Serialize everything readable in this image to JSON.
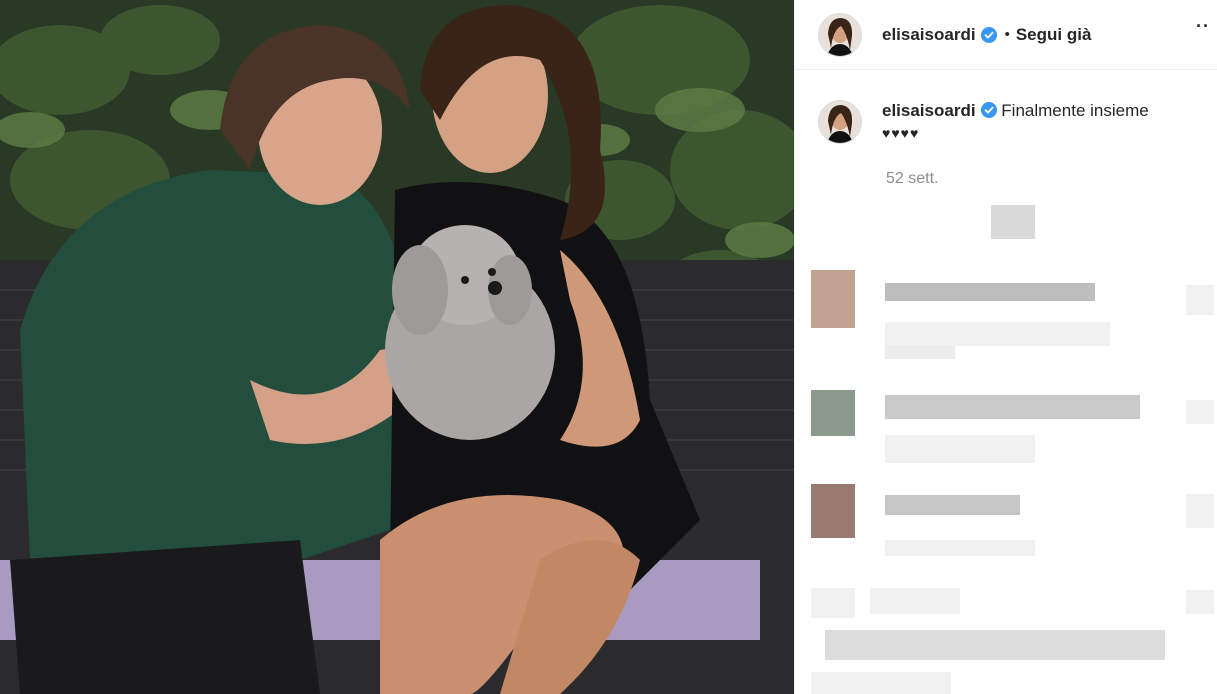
{
  "post": {
    "author": "elisaisoardi",
    "follow_status": "Segui già",
    "separator": "•",
    "more_label": "··",
    "caption": "Finalmente insieme",
    "caption_emoji": "♥♥♥♥",
    "time_ago": "52 sett."
  },
  "icons": {
    "verified": "verified-badge-icon",
    "more": "more-options-icon"
  },
  "colors": {
    "verified_blue": "#3897f0",
    "text": "#262626",
    "muted": "#8e8e8e",
    "border": "#efefef"
  }
}
